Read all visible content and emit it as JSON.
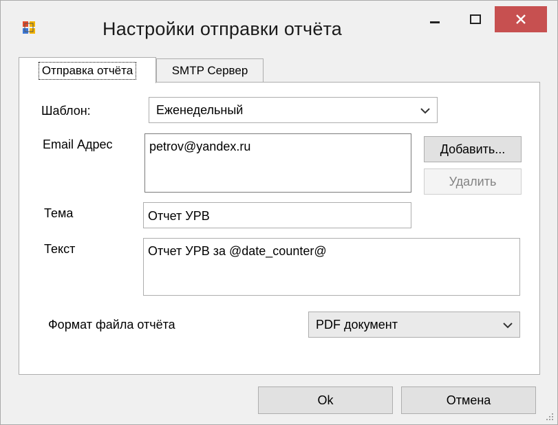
{
  "window": {
    "title": "Настройки отправки отчёта",
    "colors": {
      "close_button": "#c75050",
      "background": "#f0f0f0"
    }
  },
  "tabs": [
    {
      "label": "Отправка отчёта",
      "active": true
    },
    {
      "label": "SMTP Сервер",
      "active": false
    }
  ],
  "form": {
    "template_label": "Шаблон:",
    "template_value": "Еженедельный",
    "email_label": "Email Адрес",
    "email_value": "petrov@yandex.ru",
    "add_button": "Добавить...",
    "delete_button": "Удалить",
    "subject_label": "Тема",
    "subject_value": "Отчет УРВ",
    "text_label": "Текст",
    "text_value": "Отчет УРВ за @date_counter@",
    "format_label": "Формат файла отчёта",
    "format_value": "PDF документ"
  },
  "footer": {
    "ok_button": "Ok",
    "cancel_button": "Отмена"
  },
  "icons": [
    "app-icon",
    "minimize-icon",
    "maximize-icon",
    "close-icon",
    "chevron-down-icon",
    "resize-grip-icon"
  ]
}
